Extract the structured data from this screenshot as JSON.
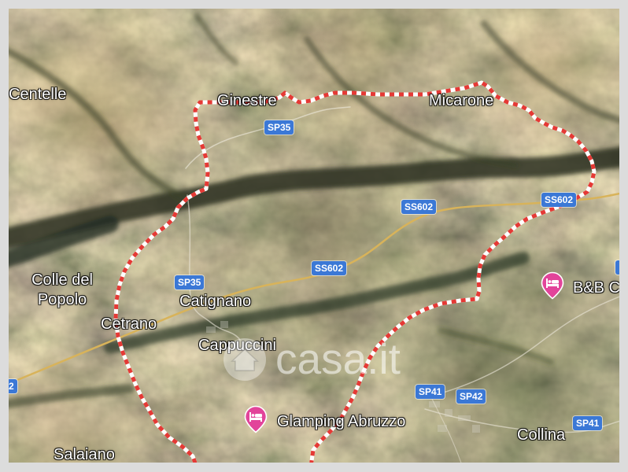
{
  "map": {
    "places": [
      {
        "name": "Centelle"
      },
      {
        "name": "Ginestre"
      },
      {
        "name": "Micarone"
      },
      {
        "name": "Colle del Popolo"
      },
      {
        "name": "Catignano"
      },
      {
        "name": "Cetrano"
      },
      {
        "name": "Cappuccini"
      },
      {
        "name": "Collina"
      },
      {
        "name": "Salaiano"
      }
    ],
    "road_shields": [
      "SP35",
      "SS602",
      "SS602",
      "SS602",
      "SP35",
      "2",
      "SP41",
      "SP42",
      "SP41"
    ],
    "pois": [
      {
        "name": "B&B C",
        "icon": "bed-icon"
      },
      {
        "name": "Glamping Abruzzo",
        "icon": "bed-icon"
      }
    ]
  },
  "watermark": {
    "text": "casa.it",
    "icon": "house-circle-icon"
  },
  "colors": {
    "road_shield": "#3b78d6",
    "poi": "#e2449a",
    "boundary_primary": "#e53935",
    "boundary_secondary": "#ffffff",
    "main_road": "#d8b35a"
  }
}
